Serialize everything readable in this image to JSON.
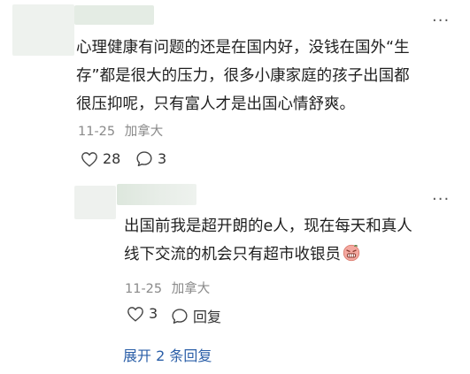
{
  "comment": {
    "text_line1": "心理健康有问题的还是在国内好，没钱在国外“生",
    "text_line2": "存”都是很大的压力，很多小康家庭的孩子出国都",
    "text_line3": "很压抑呢，只有富人才是出国心情舒爽。",
    "date": "11-25",
    "location": "加拿大",
    "likes": "28",
    "replies": "3"
  },
  "reply": {
    "text_line1": "出国前我是超开朗的e人，现在每天和真人",
    "text_line2": "线下交流的机会只有超市收银员",
    "emoji": "😖",
    "date": "11-25",
    "location": "加拿大",
    "likes": "3",
    "reply_label": "回复"
  },
  "expand_label": "展开 2 条回复",
  "icons": {
    "more": "more-dots-icon",
    "like": "heart-outline-icon",
    "comment": "comment-bubble-icon",
    "emoji": "grimace-emoji-icon"
  }
}
